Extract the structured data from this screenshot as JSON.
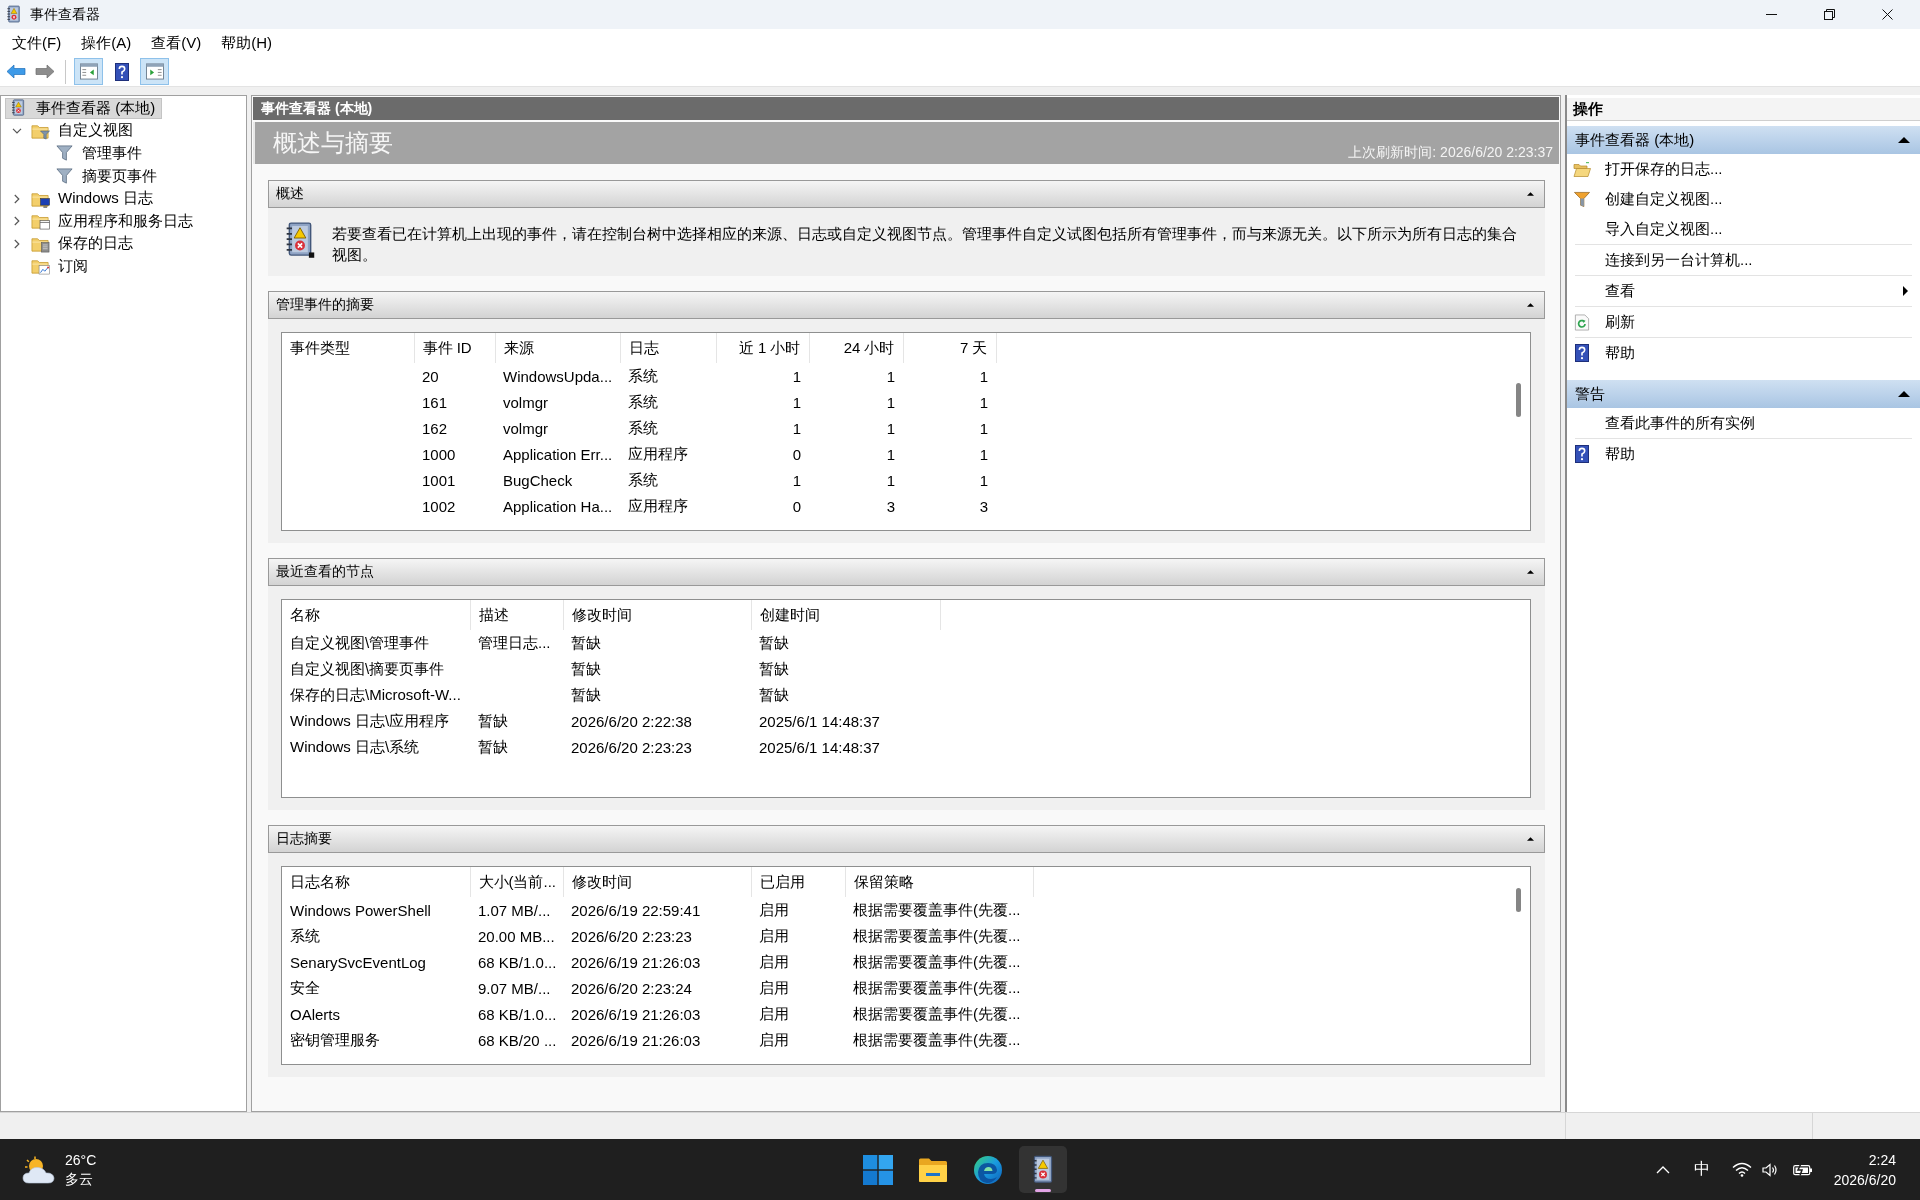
{
  "window": {
    "title": "事件查看器"
  },
  "menu": [
    "文件(F)",
    "操作(A)",
    "查看(V)",
    "帮助(H)"
  ],
  "toolbar": [
    {
      "kind": "back",
      "pressed": false,
      "disabled": false
    },
    {
      "kind": "forward",
      "pressed": false,
      "disabled": true
    },
    {
      "kind": "console-tree",
      "pressed": true,
      "disabled": false
    },
    {
      "kind": "help",
      "pressed": false,
      "disabled": false
    },
    {
      "kind": "action-pane",
      "pressed": true,
      "disabled": false
    }
  ],
  "tree": [
    {
      "label": "事件查看器 (本地)",
      "kind": "root",
      "selected": true,
      "children": [
        {
          "label": "自定义视图",
          "kind": "filter-folder",
          "expanded": true,
          "selected": false,
          "children": [
            {
              "label": "管理事件",
              "kind": "filter",
              "selected": false
            },
            {
              "label": "摘要页事件",
              "kind": "filter",
              "selected": false
            }
          ]
        },
        {
          "label": "Windows 日志",
          "kind": "windows-folder",
          "expanded": false,
          "selected": false
        },
        {
          "label": "应用程序和服务日志",
          "kind": "app-folder",
          "expanded": false,
          "selected": false
        },
        {
          "label": "保存的日志",
          "kind": "saved-folder",
          "expanded": false,
          "selected": false
        },
        {
          "label": "订阅",
          "kind": "subscription",
          "selected": false
        }
      ]
    }
  ],
  "console": {
    "header": "事件查看器 (本地)",
    "title": "概述与摘要",
    "last_refresh": "上次刷新时间: 2026/6/20 2:23:37",
    "overview": {
      "title": "概述",
      "expanded": true,
      "text": "若要查看已在计算机上出现的事件，请在控制台树中选择相应的来源、日志或自定义视图节点。管理事件自定义试图包括所有管理事件，而与来源无关。以下所示为所有日志的集合视图。"
    },
    "admin_summary": {
      "title": "管理事件的摘要",
      "expanded": true,
      "columns": [
        "事件类型",
        "事件 ID",
        "来源",
        "日志",
        "近 1 小时",
        "24 小时",
        "7 天"
      ],
      "rows": [
        {
          "event_id": "20",
          "source": "WindowsUpda...",
          "log": "系统",
          "last_hour": "1",
          "last_24_hours": "1",
          "last_7_days": "1"
        },
        {
          "event_id": "161",
          "source": "volmgr",
          "log": "系统",
          "last_hour": "1",
          "last_24_hours": "1",
          "last_7_days": "1"
        },
        {
          "event_id": "162",
          "source": "volmgr",
          "log": "系统",
          "last_hour": "1",
          "last_24_hours": "1",
          "last_7_days": "1"
        },
        {
          "event_id": "1000",
          "source": "Application Err...",
          "log": "应用程序",
          "last_hour": "0",
          "last_24_hours": "1",
          "last_7_days": "1"
        },
        {
          "event_id": "1001",
          "source": "BugCheck",
          "log": "系统",
          "last_hour": "1",
          "last_24_hours": "1",
          "last_7_days": "1"
        },
        {
          "event_id": "1002",
          "source": "Application Ha...",
          "log": "应用程序",
          "last_hour": "0",
          "last_24_hours": "3",
          "last_7_days": "3"
        }
      ]
    },
    "recent_nodes": {
      "title": "最近查看的节点",
      "expanded": true,
      "columns": [
        "名称",
        "描述",
        "修改时间",
        "创建时间"
      ],
      "rows": [
        {
          "name": "自定义视图\\管理事件",
          "description": "管理日志...",
          "modified": "暂缺",
          "created": "暂缺"
        },
        {
          "name": "自定义视图\\摘要页事件",
          "modified": "暂缺",
          "created": "暂缺"
        },
        {
          "name": "保存的日志\\Microsoft-W...",
          "modified": "暂缺",
          "created": "暂缺"
        },
        {
          "name": "Windows 日志\\应用程序",
          "description": "暂缺",
          "modified": "2026/6/20 2:22:38",
          "created": "2025/6/1 14:48:37"
        },
        {
          "name": "Windows 日志\\系统",
          "description": "暂缺",
          "modified": "2026/6/20 2:23:23",
          "created": "2025/6/1 14:48:37"
        }
      ]
    },
    "log_summary": {
      "title": "日志摘要",
      "expanded": true,
      "columns": [
        "日志名称",
        "大小(当前...",
        "修改时间",
        "已启用",
        "保留策略"
      ],
      "rows": [
        {
          "log_name": "Windows PowerShell",
          "size": "1.07 MB/...",
          "modified": "2026/6/19 22:59:41",
          "enabled": "启用",
          "retention": "根据需要覆盖事件(先覆..."
        },
        {
          "log_name": "系统",
          "size": "20.00 MB...",
          "modified": "2026/6/20 2:23:23",
          "enabled": "启用",
          "retention": "根据需要覆盖事件(先覆..."
        },
        {
          "log_name": "SenarySvcEventLog",
          "size": "68 KB/1.0...",
          "modified": "2026/6/19 21:26:03",
          "enabled": "启用",
          "retention": "根据需要覆盖事件(先覆..."
        },
        {
          "log_name": "安全",
          "size": "9.07 MB/...",
          "modified": "2026/6/20 2:23:24",
          "enabled": "启用",
          "retention": "根据需要覆盖事件(先覆..."
        },
        {
          "log_name": "OAlerts",
          "size": "68 KB/1.0...",
          "modified": "2026/6/19 21:26:03",
          "enabled": "启用",
          "retention": "根据需要覆盖事件(先覆..."
        },
        {
          "log_name": "密钥管理服务",
          "size": "68 KB/20 ...",
          "modified": "2026/6/19 21:26:03",
          "enabled": "启用",
          "retention": "根据需要覆盖事件(先覆..."
        }
      ]
    }
  },
  "actions": {
    "title": "操作",
    "sections": [
      {
        "title": "事件查看器 (本地)",
        "expanded": true,
        "groups": [
          [
            {
              "label": "打开保存的日志...",
              "kind": "open"
            },
            {
              "label": "创建自定义视图...",
              "kind": "filter"
            },
            {
              "label": "导入自定义视图...",
              "kind": "plain"
            }
          ],
          [
            {
              "label": "连接到另一台计算机...",
              "kind": "plain"
            }
          ],
          [
            {
              "label": "查看",
              "kind": "submenu"
            }
          ],
          [
            {
              "label": "刷新",
              "kind": "refresh"
            }
          ],
          [
            {
              "label": "帮助",
              "kind": "help"
            }
          ]
        ]
      },
      {
        "title": "警告",
        "expanded": true,
        "groups": [
          [
            {
              "label": "查看此事件的所有实例",
              "kind": "plain"
            }
          ],
          [
            {
              "label": "帮助",
              "kind": "help"
            }
          ]
        ]
      }
    ]
  },
  "taskbar": {
    "weather": {
      "temperature": "26°C",
      "condition": "多云"
    },
    "apps": [
      {
        "kind": "folder",
        "active": false
      },
      {
        "kind": "browser",
        "active": false
      },
      {
        "kind": "logbook",
        "active": true
      }
    ],
    "ime": "中",
    "clock": {
      "time": "2:24",
      "date": "2026/6/20"
    }
  }
}
